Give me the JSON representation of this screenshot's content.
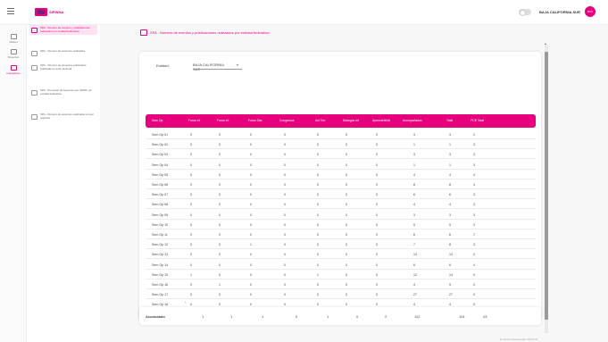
{
  "header": {
    "logo_text": "SIPINNA",
    "state": "BAJA CALIFORNIA SUR",
    "avatar": "BCS"
  },
  "rail": [
    {
      "label": "Tablero",
      "icon": "dashboard-icon",
      "active": false
    },
    {
      "label": "Reportes",
      "icon": "reports-icon",
      "active": false
    },
    {
      "label": "Indicadores",
      "icon": "indicators-icon",
      "active": true
    }
  ],
  "subnav": [
    {
      "label": "SPA - Número de eventos y publicaciones realizados por entidad federativa",
      "active": true
    },
    {
      "label": "SPA - Número de sesiones realizadas",
      "active": false
    },
    {
      "label": "SPA - Número de acuerdos publicados realizados a nivel nacional",
      "active": false
    },
    {
      "label": "SPA - Promedio de sesiones por SNDIF por entidad federativa",
      "active": false
    },
    {
      "label": "SPA - Número de sesiones realizadas a nivel regional",
      "active": false
    }
  ],
  "page": {
    "title": "SPA - Número de eventos y publicaciones realizados por entidad federativa"
  },
  "filter": {
    "label": "Entidad:",
    "value": "BAJA CALIFORNIA SUR",
    "extra": "(1)"
  },
  "table": {
    "columns": [
      "Sem Op",
      "Foros Inf",
      "Foros Int",
      "Foros Dist",
      "Congresos",
      "Act Terr",
      "Dialogos Int",
      "AprendeNNA",
      "Acompañados",
      "Total",
      "PCE Total"
    ],
    "rows": [
      [
        "Sem Op 01",
        "0",
        "0",
        "0",
        "0",
        "0",
        "0",
        "0",
        "3",
        "3",
        "2"
      ],
      [
        "Sem Op 02",
        "0",
        "0",
        "0",
        "0",
        "0",
        "0",
        "0",
        "1",
        "1",
        "3"
      ],
      [
        "Sem Op 03",
        "0",
        "0",
        "0",
        "0",
        "0",
        "0",
        "0",
        "3",
        "3",
        "3"
      ],
      [
        "Sem Op 04",
        "0",
        "0",
        "0",
        "0",
        "0",
        "0",
        "0",
        "1",
        "1",
        "3"
      ],
      [
        "Sem Op 05",
        "0",
        "0",
        "0",
        "0",
        "0",
        "0",
        "0",
        "4",
        "4",
        "4"
      ],
      [
        "Sem Op 06",
        "0",
        "0",
        "0",
        "0",
        "0",
        "0",
        "0",
        "8",
        "8",
        "4"
      ],
      [
        "Sem Op 07",
        "0",
        "0",
        "0",
        "0",
        "0",
        "0",
        "0",
        "6",
        "6",
        "3"
      ],
      [
        "Sem Op 08",
        "0",
        "0",
        "0",
        "0",
        "0",
        "0",
        "0",
        "4",
        "4",
        "3"
      ],
      [
        "Sem Op 09",
        "0",
        "0",
        "0",
        "0",
        "0",
        "0",
        "0",
        "3",
        "3",
        "3"
      ],
      [
        "Sem Op 10",
        "0",
        "0",
        "0",
        "0",
        "0",
        "0",
        "0",
        "5",
        "5",
        "3"
      ],
      [
        "Sem Op 11",
        "0",
        "0",
        "0",
        "0",
        "0",
        "0",
        "0",
        "6",
        "6",
        "7"
      ],
      [
        "Sem Op 12",
        "0",
        "0",
        "1",
        "0",
        "0",
        "0",
        "0",
        "7",
        "8",
        "3"
      ],
      [
        "Sem Op 13",
        "0",
        "0",
        "0",
        "0",
        "0",
        "0",
        "0",
        "13",
        "13",
        "0"
      ],
      [
        "Sem Op 14",
        "0",
        "0",
        "0",
        "0",
        "0",
        "0",
        "0",
        "6",
        "6",
        "4"
      ],
      [
        "Sem Op 15",
        "1",
        "0",
        "0",
        "0",
        "1",
        "0",
        "0",
        "12",
        "14",
        "0"
      ],
      [
        "Sem Op 16",
        "0",
        "1",
        "0",
        "0",
        "0",
        "0",
        "0",
        "4",
        "5",
        "0"
      ],
      [
        "Sem Op 17",
        "0",
        "0",
        "0",
        "0",
        "0",
        "0",
        "0",
        "27",
        "27",
        "0"
      ],
      [
        "Sem Op 18",
        "0",
        "0",
        "0",
        "0",
        "0",
        "0",
        "0",
        "4",
        "4",
        "0"
      ]
    ]
  },
  "totals": {
    "label": "Acumulado",
    "values": [
      "1",
      "1",
      "1",
      "0",
      "1",
      "0",
      "2",
      "112",
      "119",
      "43"
    ]
  },
  "footer": "Derechos Reservados SIPINNA"
}
